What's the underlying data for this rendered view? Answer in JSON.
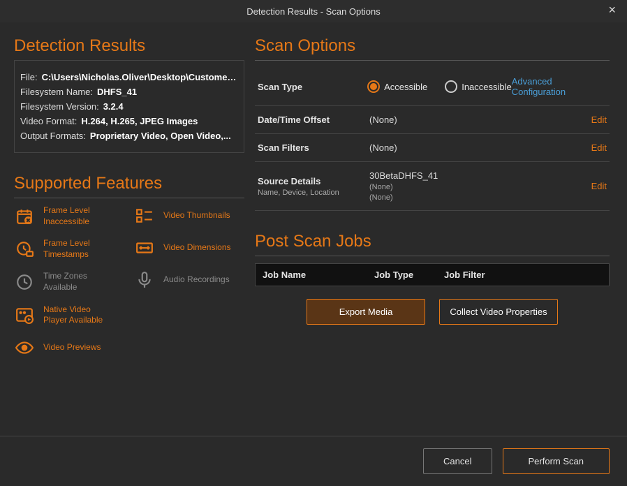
{
  "window": {
    "title": "Detection Results - Scan Options"
  },
  "left": {
    "heading": "Detection Results",
    "file_label": "File:",
    "file_value": "C:\\Users\\Nicholas.Oliver\\Desktop\\Customer Suc...",
    "fsname_label": "Filesystem Name:",
    "fsname_value": "DHFS_41",
    "fsver_label": "Filesystem Version:",
    "fsver_value": "3.2.4",
    "vfmt_label": "Video Format:",
    "vfmt_value": "H.264, H.265, JPEG Images",
    "ofmt_label": "Output Formats:",
    "ofmt_value": "Proprietary Video, Open Video,...",
    "features_heading": "Supported Features",
    "feat": {
      "frame_inaccessible": "Frame Level Inaccessible",
      "frame_timestamps": "Frame Level Timestamps",
      "timezones": "Time Zones Available",
      "native_player": "Native Video Player Available",
      "video_previews": "Video Previews",
      "video_thumbs": "Video Thumbnails",
      "video_dims": "Video Dimensions",
      "audio": "Audio Recordings"
    }
  },
  "right": {
    "heading": "Scan Options",
    "scan_type_label": "Scan Type",
    "accessible": "Accessible",
    "inaccessible": "Inaccessible",
    "advanced": "Advanced Configuration",
    "datetime_label": "Date/Time Offset",
    "datetime_value": "(None)",
    "filters_label": "Scan Filters",
    "filters_value": "(None)",
    "source_label": "Source Details",
    "source_sublabel": "Name, Device, Location",
    "source_name": "30BetaDHFS_41",
    "source_device": "(None)",
    "source_location": "(None)",
    "edit": "Edit",
    "post_heading": "Post Scan Jobs",
    "col_jobname": "Job Name",
    "col_jobtype": "Job Type",
    "col_jobfilter": "Job Filter",
    "btn_export": "Export Media",
    "btn_collect": "Collect Video Properties"
  },
  "footer": {
    "cancel": "Cancel",
    "perform": "Perform Scan"
  }
}
